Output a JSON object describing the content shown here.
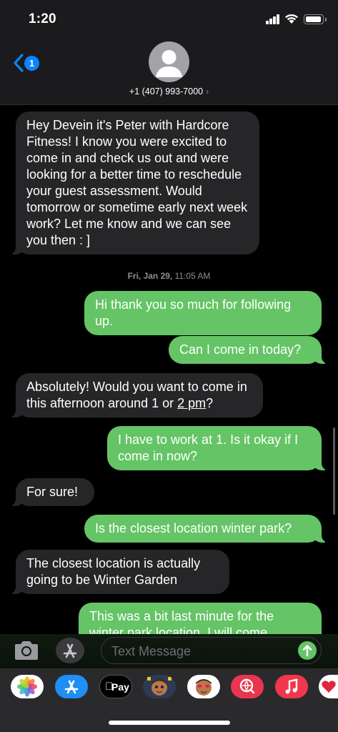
{
  "status_bar": {
    "time": "1:20"
  },
  "header": {
    "back_badge": "1",
    "contact": "+1 (407) 993-7000",
    "contact_chevron": "›"
  },
  "thread": {
    "messages": [
      {
        "side": "in",
        "text": "Hey Devein it's Peter with Hardcore Fitness! I know you were excited to come in and check us out and were looking for a better time to reschedule your guest assessment. Would tomorrow or sometime early next week work? Let me know and we can see you then : ]"
      },
      {
        "side": "out",
        "text": "Hi thank you so much for following up."
      },
      {
        "side": "out",
        "text": "Can I come in today?"
      },
      {
        "side": "in",
        "text_before": "Absolutely! Would you want to come in this afternoon around 1 or ",
        "text_link": "2 pm",
        "text_after": "?"
      },
      {
        "side": "out",
        "text": "I have to work at 1. Is it okay if I come in now?"
      },
      {
        "side": "in",
        "text": "For sure!"
      },
      {
        "side": "out",
        "text": "Is the closest location winter park?"
      },
      {
        "side": "in",
        "text": "The closest location is actually going to be Winter Garden"
      },
      {
        "side": "out",
        "text": "This was a bit last minute for the winter park location. I will come"
      }
    ],
    "timestamp_day": "Fri, Jan 29,",
    "timestamp_time": "11:05 AM"
  },
  "input": {
    "placeholder": "Text Message"
  },
  "app_drawer": {
    "apps": [
      "photos-app-icon",
      "app-store-icon",
      "apple-pay-icon",
      "memoji-icon-1",
      "memoji-icon-2",
      "image-search-icon",
      "music-icon",
      "heart-app-icon"
    ],
    "apple_pay_label": "Pay"
  },
  "colors": {
    "incoming": "#262628",
    "outgoing": "#65c466",
    "accent": "#0a84ff"
  }
}
